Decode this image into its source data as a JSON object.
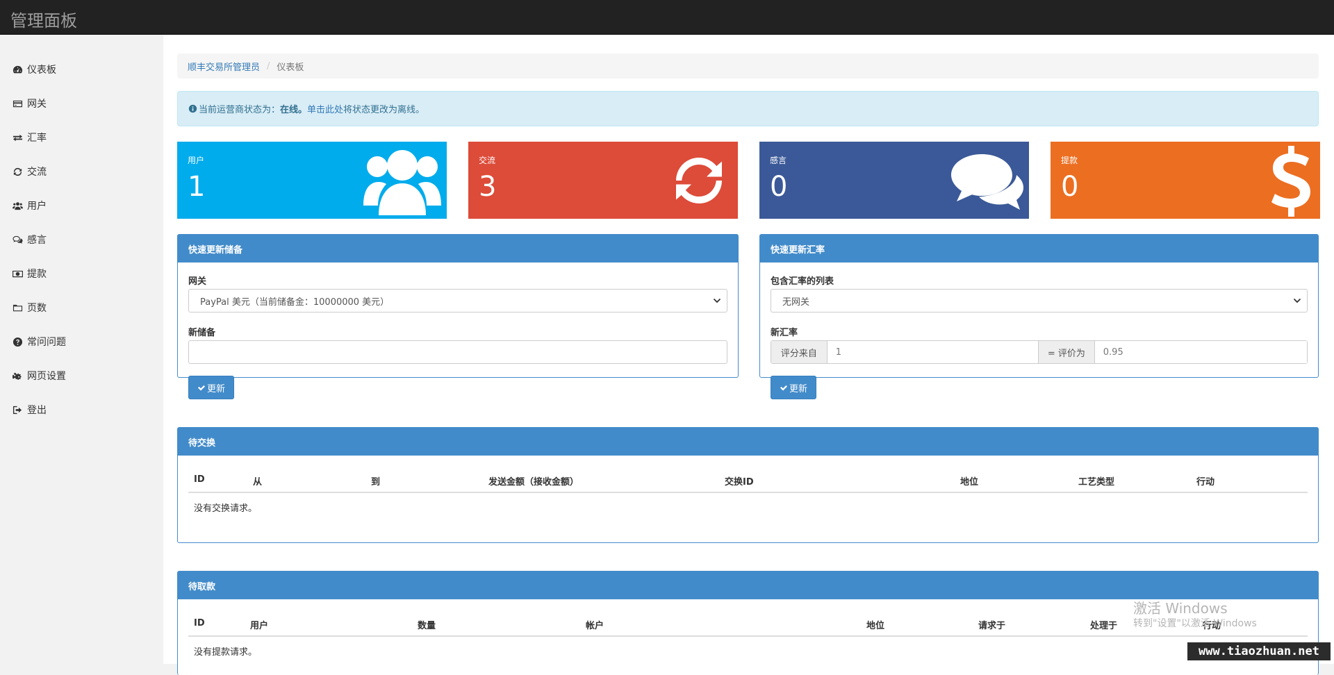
{
  "brand": "管理面板",
  "sidebar": {
    "items": [
      {
        "label": "仪表板",
        "icon": "dashboard-icon"
      },
      {
        "label": "网关",
        "icon": "credit-card-icon"
      },
      {
        "label": "汇率",
        "icon": "exchange-icon"
      },
      {
        "label": "交流",
        "icon": "refresh-icon"
      },
      {
        "label": "用户",
        "icon": "users-icon"
      },
      {
        "label": "感言",
        "icon": "comments-icon"
      },
      {
        "label": "提款",
        "icon": "money-icon"
      },
      {
        "label": "页数",
        "icon": "folder-icon"
      },
      {
        "label": "常问问题",
        "icon": "question-circle-icon"
      },
      {
        "label": "网页设置",
        "icon": "cogs-icon"
      },
      {
        "label": "登出",
        "icon": "sign-out-icon"
      }
    ]
  },
  "breadcrumb": {
    "root": "顺丰交易所管理员",
    "separator": "/",
    "current": "仪表板"
  },
  "alert": {
    "prefix": "当前运营商状态为：",
    "status": "在线。",
    "link": "单击此处",
    "suffix": "将状态更改为离线。"
  },
  "stats": [
    {
      "label": "用户",
      "value": "1",
      "color": "#00acec",
      "icon": "users-icon"
    },
    {
      "label": "交流",
      "value": "3",
      "color": "#dd4b39",
      "icon": "refresh-icon"
    },
    {
      "label": "感言",
      "value": "0",
      "color": "#3b5998",
      "icon": "comments-icon"
    },
    {
      "label": "提款",
      "value": "0",
      "color": "#ec6e21",
      "icon": "dollar-icon"
    }
  ],
  "reserve_panel": {
    "title": "快速更新储备",
    "gateway_label": "网关",
    "gateway_value": "PayPal 美元（当前储备金：10000000 美元）",
    "new_reserve_label": "新储备",
    "new_reserve_value": "",
    "button": "更新"
  },
  "rate_panel": {
    "title": "快速更新汇率",
    "list_label": "包含汇率的列表",
    "list_value": "无网关",
    "new_rate_label": "新汇率",
    "from_addon": "评分来自",
    "from_value": "1",
    "to_addon": "= 评价为",
    "to_value": "0.95",
    "button": "更新"
  },
  "exchanges_panel": {
    "title": "待交换",
    "columns": [
      "ID",
      "从",
      "到",
      "发送金额（接收金额）",
      "交换ID",
      "地位",
      "工艺类型",
      "行动"
    ],
    "empty": "没有交换请求。"
  },
  "withdrawals_panel": {
    "title": "待取款",
    "columns": [
      "ID",
      "用户",
      "数量",
      "帐户",
      "地位",
      "请求于",
      "处理于",
      "行动"
    ],
    "empty": "没有提款请求。"
  },
  "watermark": {
    "title": "激活 Windows",
    "subtitle": "转到\"设置\"以激活 Windows"
  },
  "site_mark": "www.tiaozhuan.net",
  "colors": {
    "topbar": "#222222",
    "primary": "#428bca",
    "alert_bg": "#d9edf7"
  }
}
